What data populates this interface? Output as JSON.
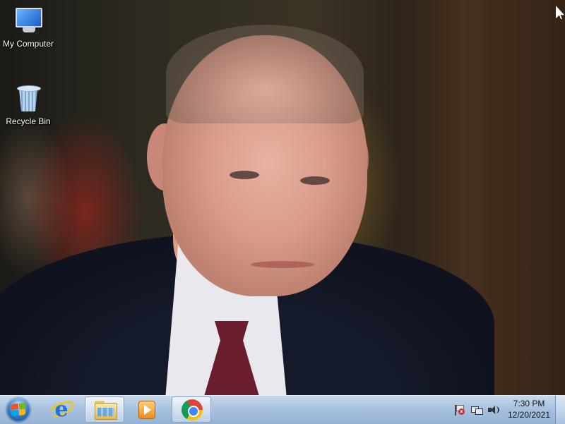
{
  "desktop": {
    "wallpaper": "photo-wallpaper",
    "icons": [
      {
        "label": "My Computer",
        "icon": "computer-icon"
      },
      {
        "label": "Recycle Bin",
        "icon": "recycle-bin-icon"
      }
    ]
  },
  "taskbar": {
    "start": {
      "icon": "windows-start-icon"
    },
    "pinned": [
      {
        "icon": "internet-explorer-icon"
      },
      {
        "icon": "windows-explorer-icon"
      },
      {
        "icon": "media-player-icon"
      },
      {
        "icon": "chrome-icon",
        "active": true
      }
    ],
    "tray": {
      "icons": [
        "action-center-flag-icon",
        "network-icon",
        "volume-icon"
      ],
      "time": "7:30 PM",
      "date": "12/20/2021"
    }
  },
  "colors": {
    "taskbar": "#a9c2df",
    "label_text": "#ffffff"
  }
}
